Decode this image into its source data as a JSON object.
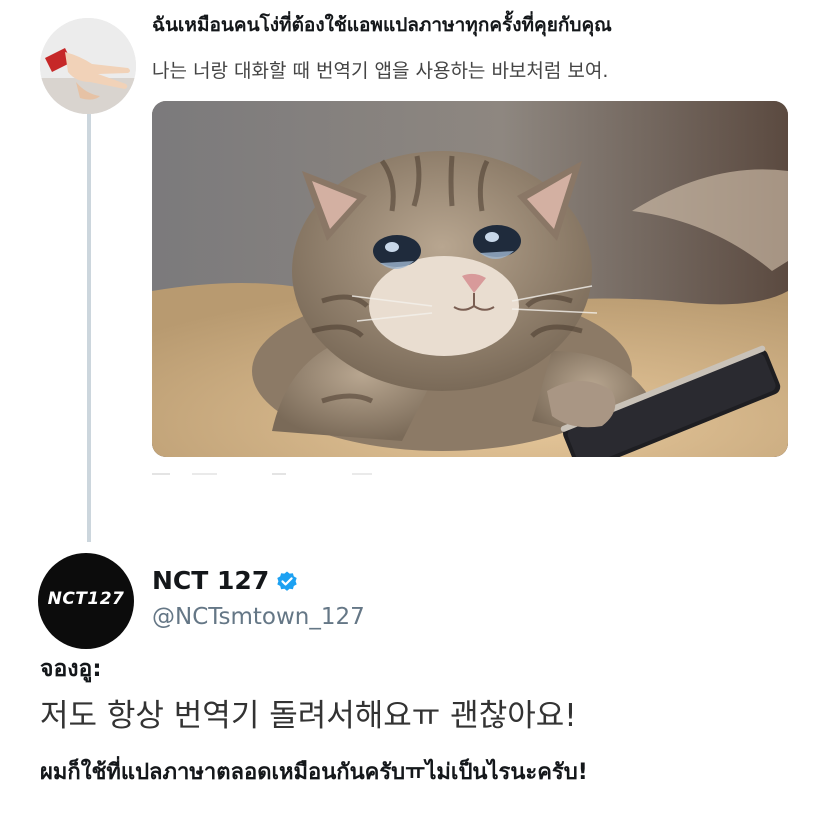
{
  "reply_tweet": {
    "thai_text": "ฉันเหมือนคนโง่ที่ต้องใช้แอพแปลภาษาทุกครั้งที่คุยกับคุณ",
    "korean_text": "나는 너랑 대화할 때 번역기 앱을 사용하는 바보처럼 보여.",
    "avatar_icon": "hand-gesture-avatar",
    "media_description_icon": "crying-cat-holding-phone-photo"
  },
  "main_tweet": {
    "display_name": "NCT 127",
    "verified_icon": "verified-badge-icon",
    "handle": "@NCTsmtown_127",
    "avatar_logo_text": "NCT127",
    "speaker_label": "จองอู:",
    "korean_text": "저도 항상 번역기 돌려서해요ㅠ 괜찮아요!",
    "thai_text": "ผมก็ใช้ที่แปลภาษาตลอดเหมือนกันครับㅠไม่เป็นไรนะครับ!"
  },
  "colors": {
    "verified_blue": "#1da1f2",
    "thread_line": "#ccd6dd",
    "secondary_text": "#657786"
  }
}
